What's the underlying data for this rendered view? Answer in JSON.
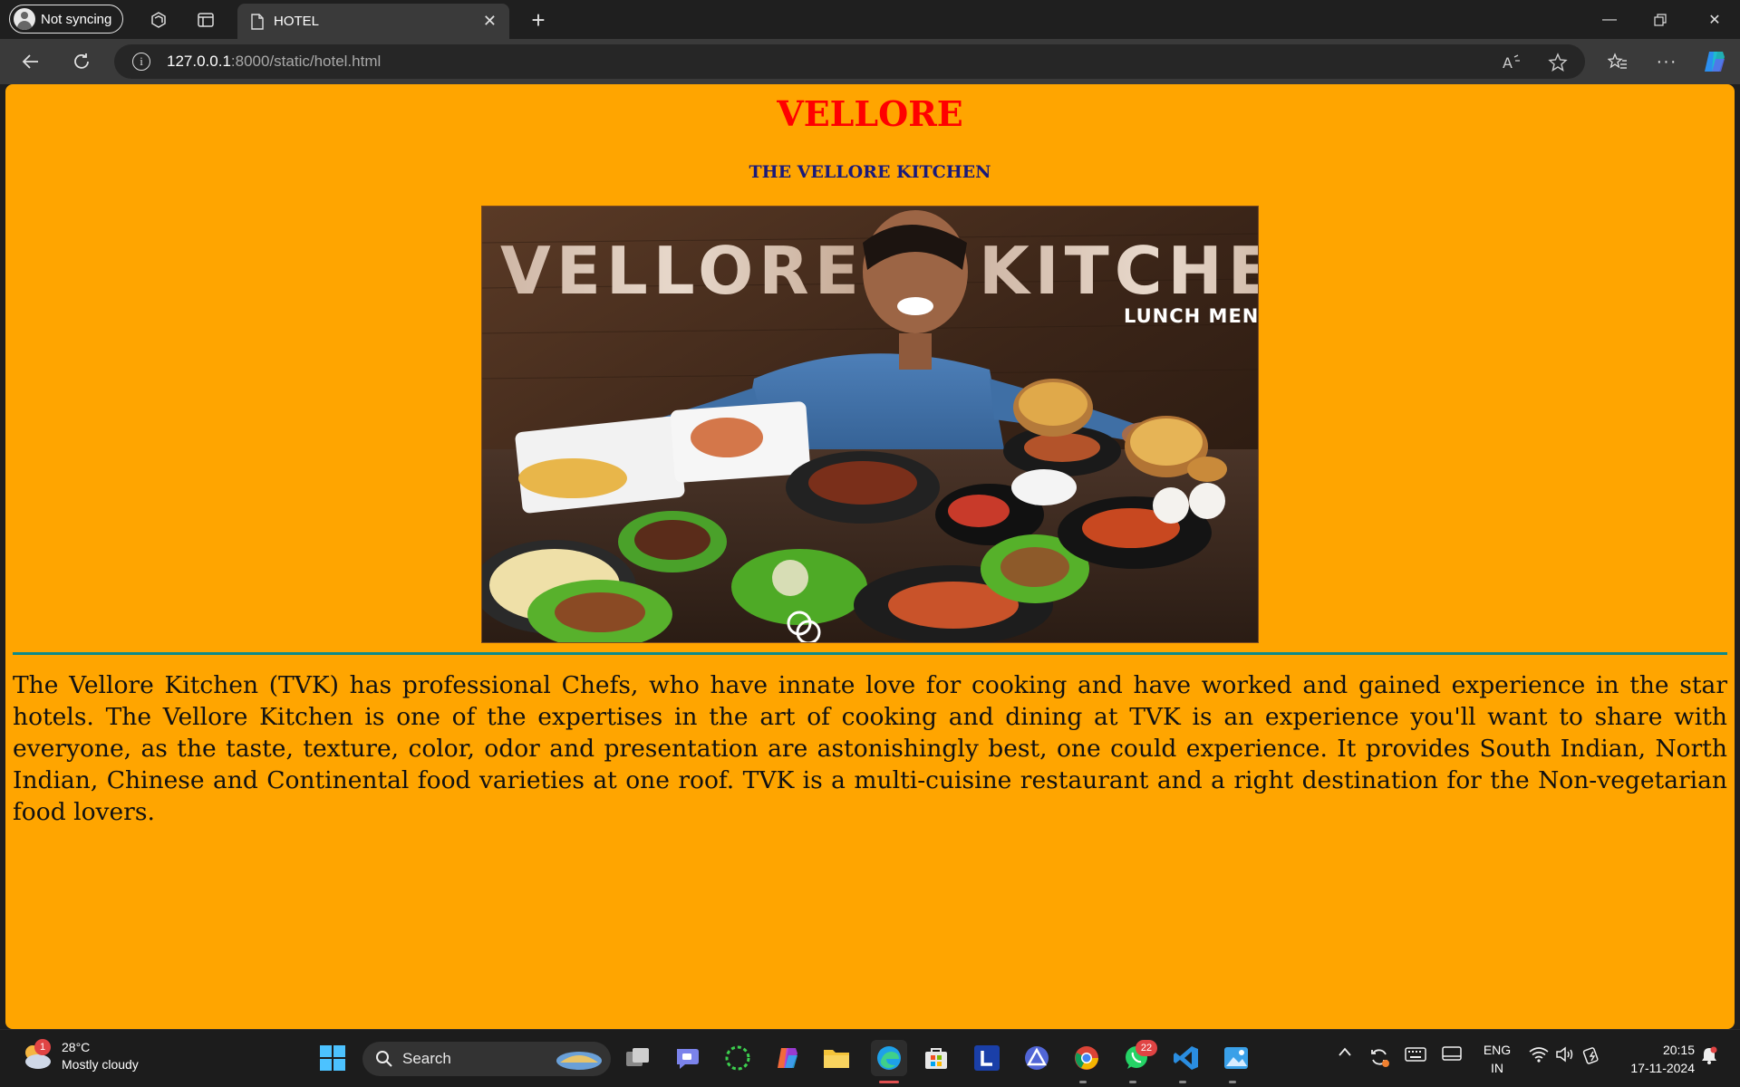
{
  "browser": {
    "profile_label": "Not syncing",
    "tab_title": "HOTEL",
    "url_host": "127.0.0.1",
    "url_path": ":8000/static/hotel.html"
  },
  "page": {
    "heading": "VELLORE",
    "subheading": "THE VELLORE KITCHEN",
    "banner": {
      "title_left": "VELLORE",
      "title_right": "KITCHEN",
      "menu_label": "LUNCH MENU"
    },
    "description": "The Vellore Kitchen (TVK) has professional Chefs, who have innate love for cooking and have worked and gained experience in the star hotels. The Vellore Kitchen is one of the expertises in the art of cooking and dining at TVK is an experience you'll want to share with everyone, as the taste, texture, color, odor and presentation are astonishingly best, one could experience. It provides South Indian, North Indian, Chinese and Continental food varieties at one roof. TVK is a multi-cuisine restaurant and a right destination for the Non-vegetarian food lovers.",
    "colors": {
      "background": "#ffa500",
      "heading": "#ff0000",
      "subheading": "#1a1a7a",
      "rule": "#0d8a8a"
    }
  },
  "taskbar": {
    "weather_badge": "1",
    "temperature": "28°C",
    "condition": "Mostly cloudy",
    "search_label": "Search",
    "whatsapp_badge": "22",
    "lang_top": "ENG",
    "lang_bottom": "IN",
    "time": "20:15",
    "date": "17-11-2024"
  }
}
